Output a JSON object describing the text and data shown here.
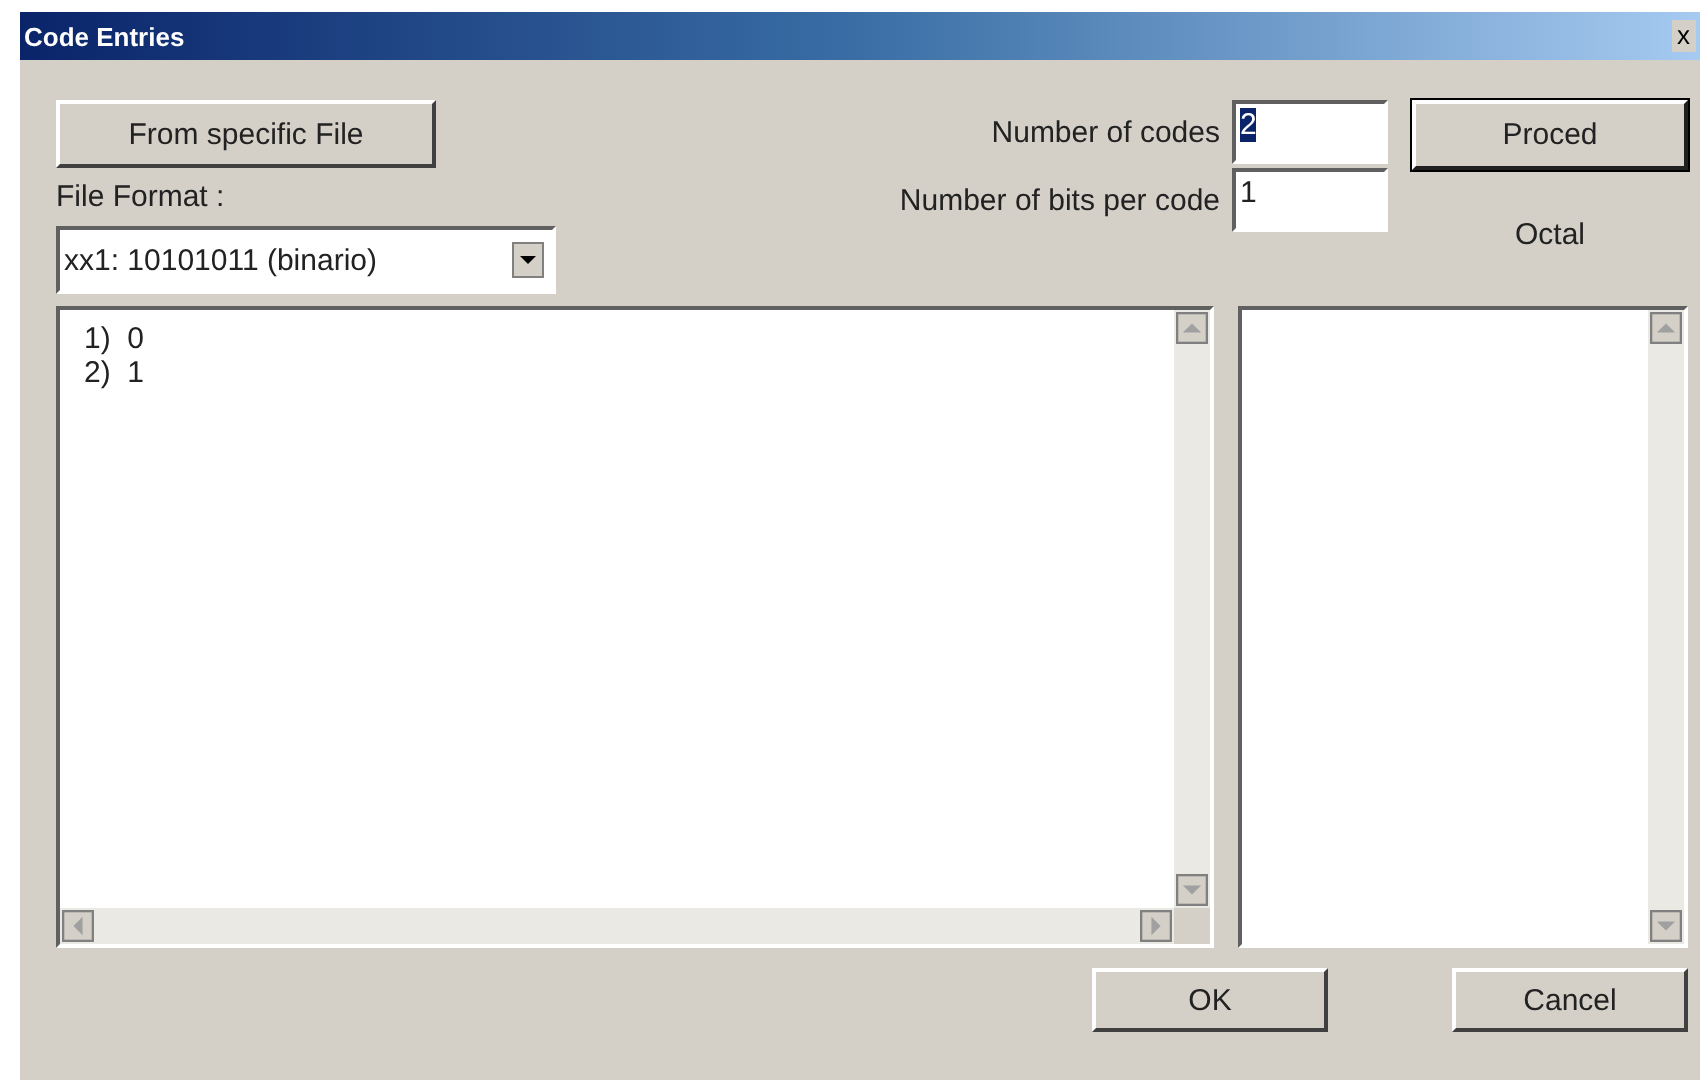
{
  "window": {
    "title": "Code Entries",
    "close": "x"
  },
  "file_button": "From specific File",
  "file_format": {
    "label": "File Format :",
    "value": "xx1: 10101011 (binario)"
  },
  "fields": [
    {
      "label": "Number of codes",
      "value": "2",
      "text_selected": true
    },
    {
      "label": "Number of bits per code",
      "value": "1",
      "text_selected": false
    }
  ],
  "proceed_button": "Proced",
  "codes_list": {
    "lines": [
      "1)  0",
      "2)  1"
    ]
  },
  "octal": {
    "label": "Octal"
  },
  "buttons": [
    "OK",
    "Cancel"
  ]
}
